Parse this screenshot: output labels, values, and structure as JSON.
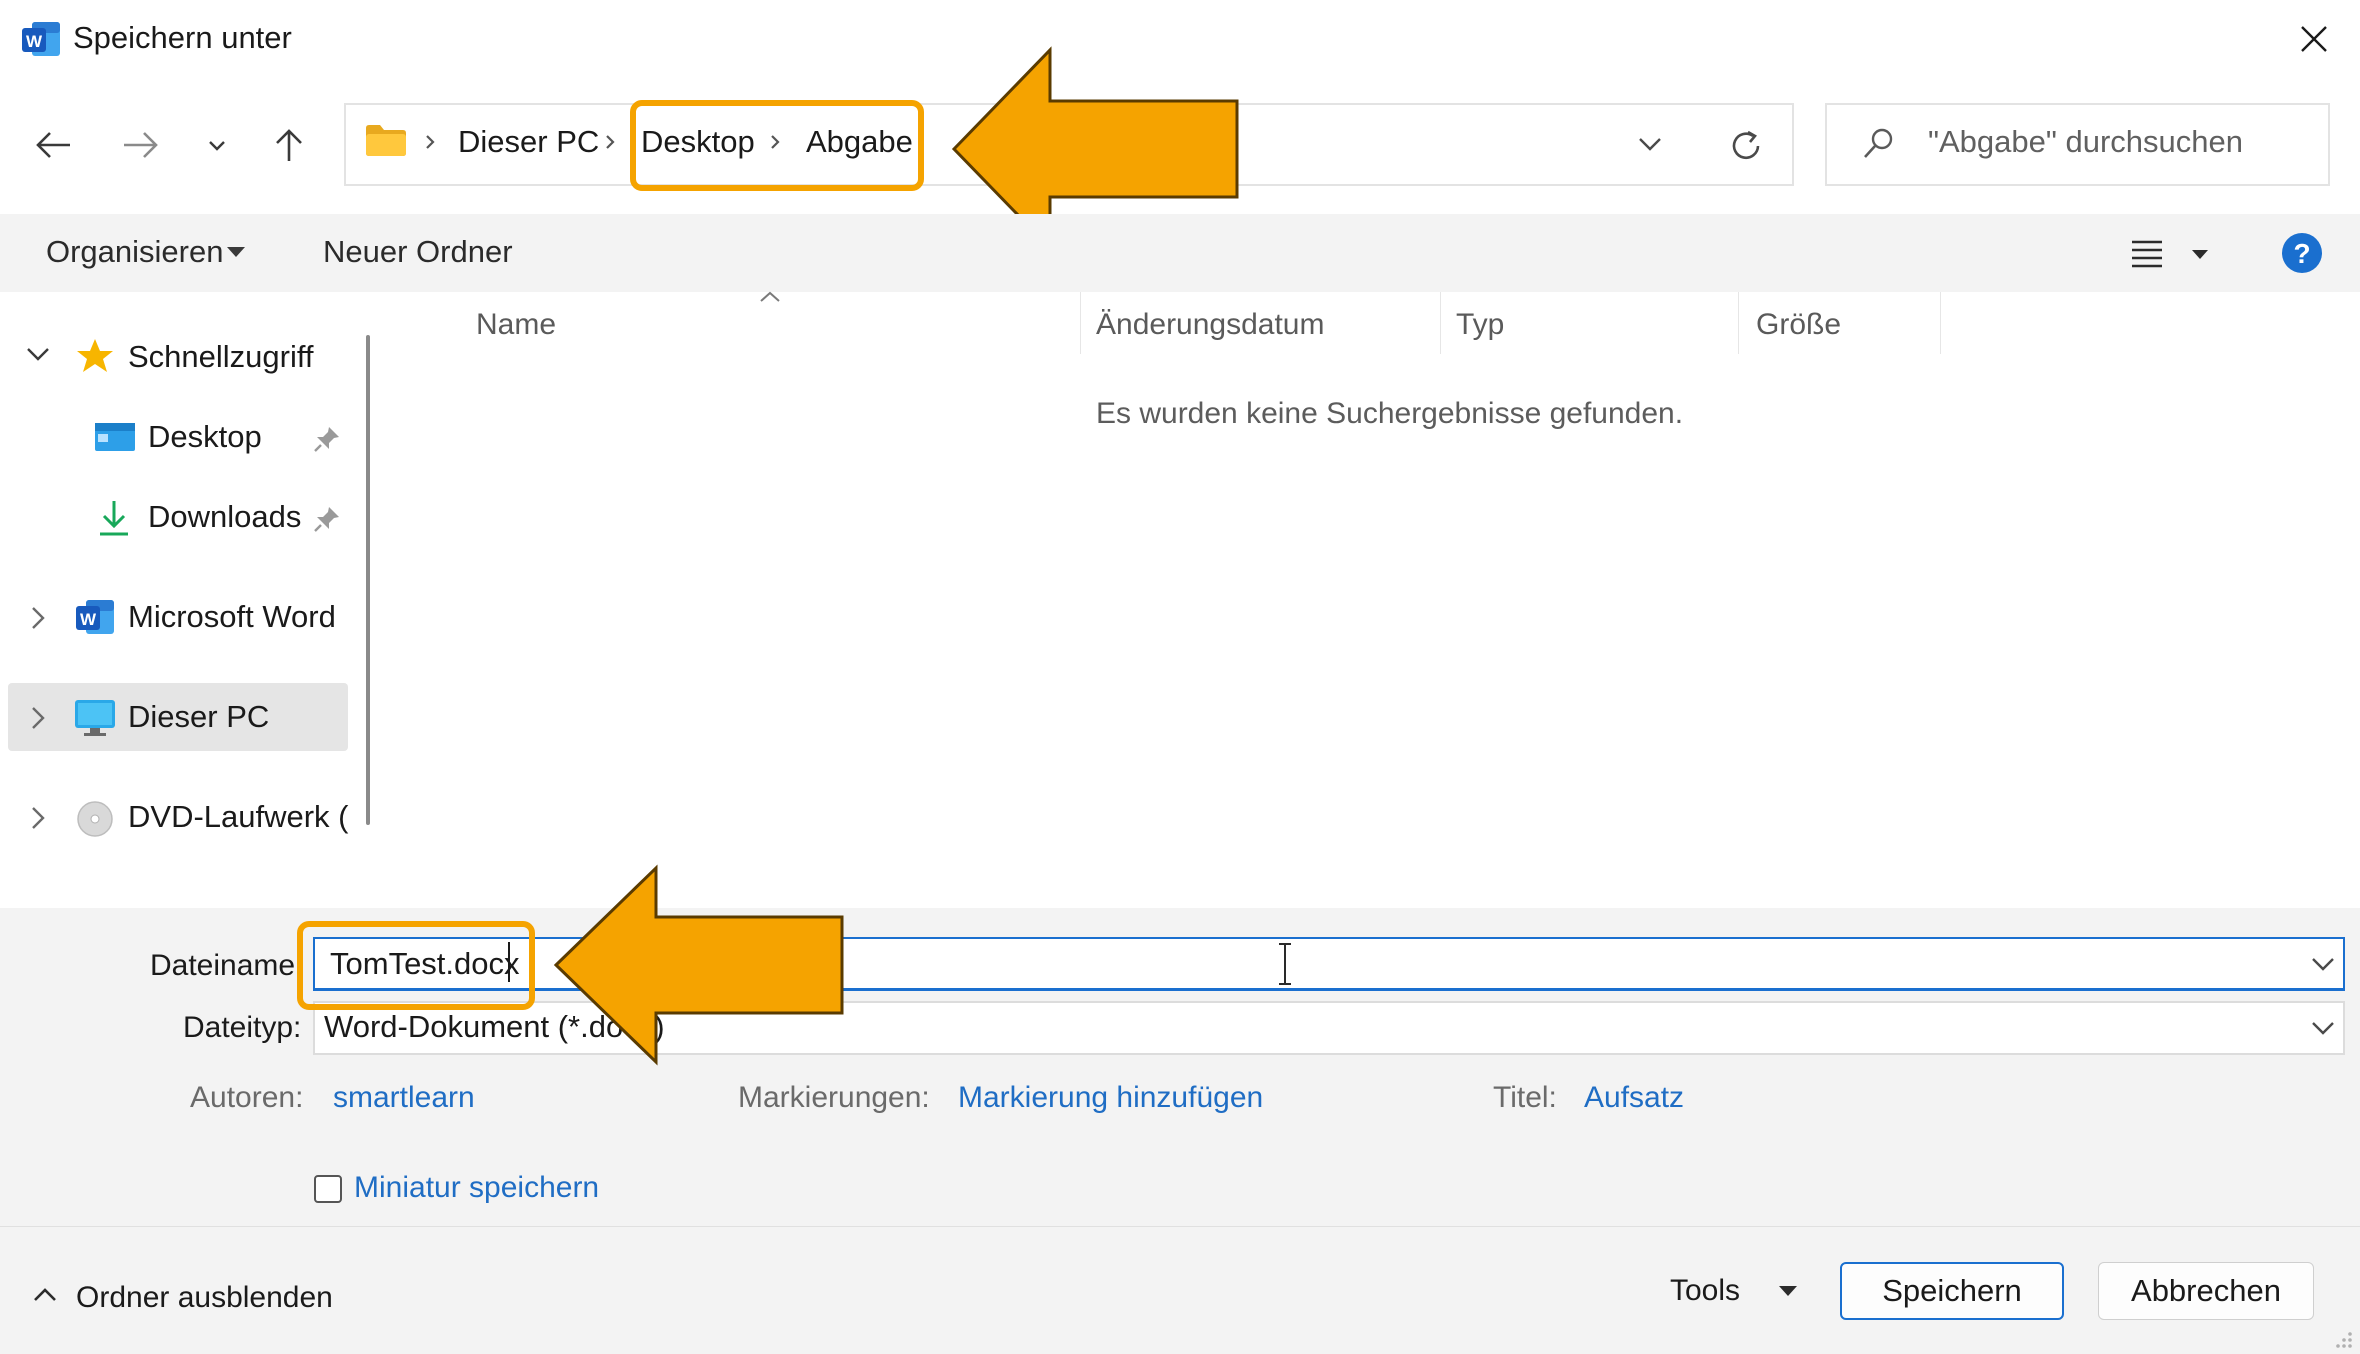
{
  "window": {
    "title": "Speichern unter",
    "app_icon": "word-icon",
    "close_icon": "close-icon"
  },
  "nav": {
    "back_icon": "arrow-left-icon",
    "forward_icon": "arrow-right-icon",
    "recent_icon": "chevron-down-icon",
    "up_icon": "arrow-up-icon"
  },
  "address": {
    "folder_icon": "folder-icon",
    "crumbs": [
      "Dieser PC",
      "Desktop",
      "Abgabe"
    ],
    "dropdown_icon": "chevron-down-icon",
    "refresh_icon": "refresh-icon"
  },
  "search": {
    "placeholder": "\"Abgabe\" durchsuchen",
    "icon": "search-icon"
  },
  "commandbar": {
    "organize_label": "Organisieren",
    "new_folder_label": "Neuer Ordner",
    "view_icon": "list-view-icon",
    "help_icon": "help-icon"
  },
  "tree": {
    "items": [
      {
        "label": "Schnellzugriff",
        "icon": "star-icon",
        "expanded": true
      },
      {
        "label": "Desktop",
        "icon": "desktop-icon",
        "pinned": true
      },
      {
        "label": "Downloads",
        "icon": "download-icon",
        "pinned": true
      },
      {
        "label": "Microsoft Word",
        "icon": "word-icon",
        "expanded": false
      },
      {
        "label": "Dieser PC",
        "icon": "monitor-icon",
        "expanded": false,
        "selected": true
      },
      {
        "label": "DVD-Laufwerk (D",
        "icon": "disc-icon",
        "expanded": false
      }
    ]
  },
  "filelist": {
    "columns": [
      "Name",
      "Änderungsdatum",
      "Typ",
      "Größe"
    ],
    "empty_message": "Es wurden keine Suchergebnisse gefunden."
  },
  "form": {
    "filename_label": "Dateiname:",
    "filename_value": "TomTest.docx",
    "filetype_label": "Dateityp:",
    "filetype_value": "Word-Dokument (*.docx)",
    "authors_label": "Autoren:",
    "authors_value": "smartlearn",
    "tags_label": "Markierungen:",
    "tags_value": "Markierung hinzufügen",
    "title_label": "Titel:",
    "title_value": "Aufsatz",
    "thumbnail_label": "Miniatur speichern",
    "thumbnail_checked": false
  },
  "footer": {
    "hide_folders_label": "Ordner ausblenden",
    "tools_label": "Tools",
    "save_label": "Speichern",
    "cancel_label": "Abbrechen"
  },
  "colors": {
    "highlight": "#f5a300",
    "accent": "#1a6fcf",
    "link": "#1f6dc4"
  }
}
